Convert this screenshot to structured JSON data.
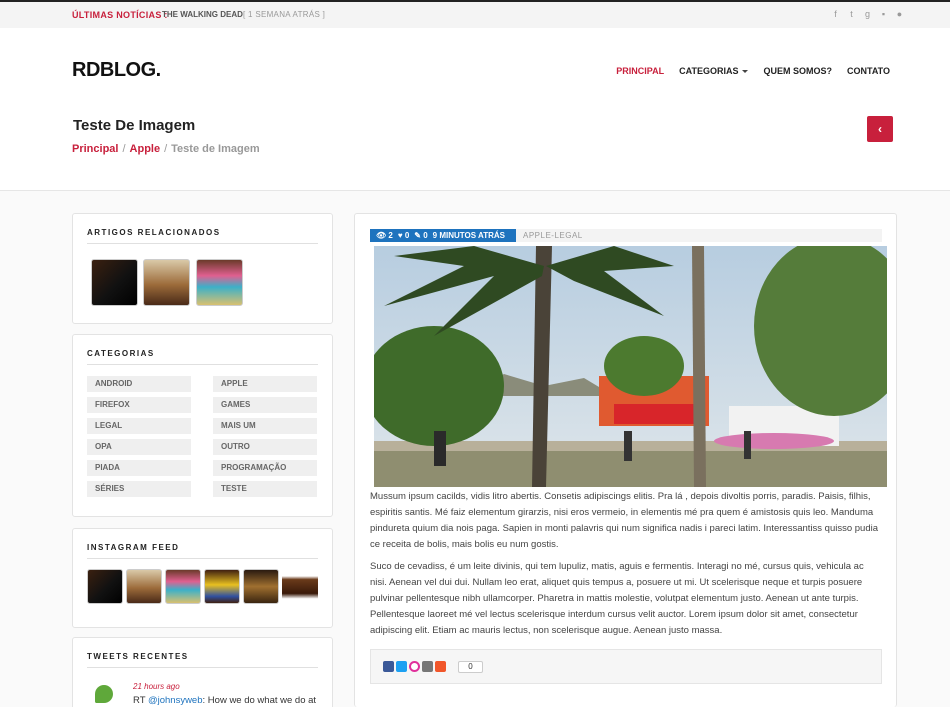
{
  "topbar": {
    "news_label": "ÚLTIMAS NOTÍCIAS :",
    "news_title": "THE WALKING DEAD",
    "news_time": "[ 1 SEMANA ATRÁS ]",
    "social_icons": [
      "facebook-icon",
      "twitter-icon",
      "google-plus-icon",
      "flickr-icon",
      "apple-icon"
    ]
  },
  "header": {
    "logo": "RDBLOG.",
    "nav": [
      "PRINCIPAL",
      "CATEGORIAS",
      "QUEM SOMOS?",
      "CONTATO"
    ],
    "page_title": "Teste De Imagem",
    "breadcrumb": [
      "Principal",
      "Apple",
      "Teste de Imagem"
    ],
    "back_icon": "‹"
  },
  "sidebar": {
    "related_title": "ARTIGOS RELACIONADOS",
    "categories_title": "CATEGORIAS",
    "categories": [
      "ANDROID",
      "APPLE",
      "FIREFOX",
      "GAMES",
      "LEGAL",
      "MAIS UM",
      "OPA",
      "OUTRO",
      "PIADA",
      "PROGRAMAÇÃO",
      "SÉRIES",
      "TESTE"
    ],
    "instagram_title": "INSTAGRAM FEED",
    "tweets_title": "TWEETS RECENTES",
    "tweet": {
      "time": "21 hours ago",
      "prefix": "RT ",
      "mention": "@johnsyweb",
      "text": ": How we do what we do at"
    }
  },
  "post": {
    "views": "2",
    "likes": "0",
    "comments": "0",
    "time": "9 MINUTOS ATRÁS",
    "tag": "APPLE-LEGAL",
    "paragraph_1": "Mussum ipsum cacilds, vidis litro abertis. Consetis adipiscings elitis. Pra lá , depois divoltis porris, paradis. Paisis, filhis, espiritis santis. Mé faiz elementum girarzis, nisi eros vermeio, in elementis mé pra quem é amistosis quis leo. Manduma pindureta quium dia nois paga. Sapien in monti palavris qui num significa nadis i pareci latim. Interessantiss quisso pudia ce receita de bolis, mais bolis eu num gostis.",
    "paragraph_2": "Suco de cevadiss, é um leite divinis, qui tem lupuliz, matis, aguis e fermentis. Interagi no mé, cursus quis, vehicula ac nisi. Aenean vel dui dui. Nullam leo erat, aliquet quis tempus a, posuere ut mi. Ut scelerisque neque et turpis posuere pulvinar pellentesque nibh ullamcorper. Pharetra in mattis molestie, volutpat elementum justo. Aenean ut ante turpis. Pellentesque laoreet mé vel lectus scelerisque interdum cursus velit auctor. Lorem ipsum dolor sit amet, consectetur adipiscing elit. Etiam ac mauris lectus, non scelerisque augue. Aenean justo massa.",
    "share_count": "0"
  },
  "colors": {
    "accent": "#c8203c",
    "meta_blue": "#1e73be"
  }
}
